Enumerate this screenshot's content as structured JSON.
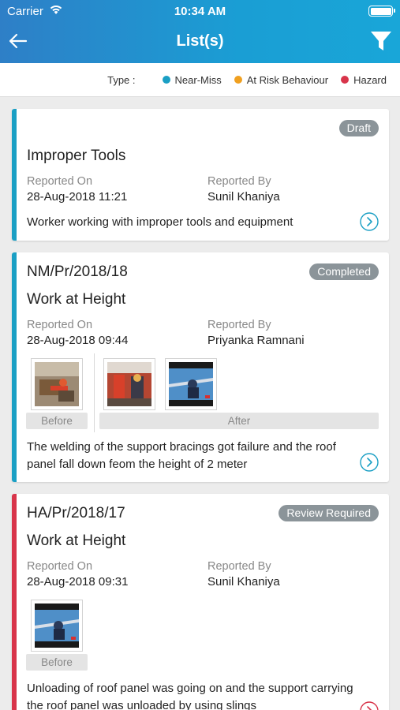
{
  "status_bar": {
    "carrier": "Carrier",
    "time": "10:34 AM"
  },
  "nav": {
    "title": "List(s)",
    "back_icon": "arrow-left-icon",
    "filter_icon": "filter-icon"
  },
  "legend": {
    "label": "Type :",
    "items": [
      {
        "label": "Near-Miss",
        "color": "#1a9fc4"
      },
      {
        "label": "At Risk Behaviour",
        "color": "#f0a020"
      },
      {
        "label": "Hazard",
        "color": "#d8344a"
      }
    ]
  },
  "cards": [
    {
      "number": "",
      "status": "Draft",
      "title": "Improper Tools",
      "reported_on_label": "Reported On",
      "reported_on": "28-Aug-2018 11:21",
      "reported_by_label": "Reported By",
      "reported_by": "Sunil Khaniya",
      "description": "Worker working with improper tools and equipment",
      "type_color": "#1a9fc4"
    },
    {
      "number": "NM/Pr/2018/18",
      "status": "Completed",
      "title": "Work at Height",
      "reported_on_label": "Reported On",
      "reported_on": "28-Aug-2018 09:44",
      "reported_by_label": "Reported By",
      "reported_by": "Priyanka Ramnani",
      "before_label": "Before",
      "after_label": "After",
      "description": "The welding of the support bracings got failure and the roof panel fall down feom the height of 2 meter",
      "type_color": "#1a9fc4"
    },
    {
      "number": "HA/Pr/2018/17",
      "status": "Review Required",
      "title": "Work at Height",
      "reported_on_label": "Reported On",
      "reported_on": "28-Aug-2018 09:31",
      "reported_by_label": "Reported By",
      "reported_by": "Sunil Khaniya",
      "before_label": "Before",
      "description": "Unloading of roof panel was going on and the support carrying the roof panel was unloaded by using slings",
      "type_color": "#d8344a"
    }
  ]
}
